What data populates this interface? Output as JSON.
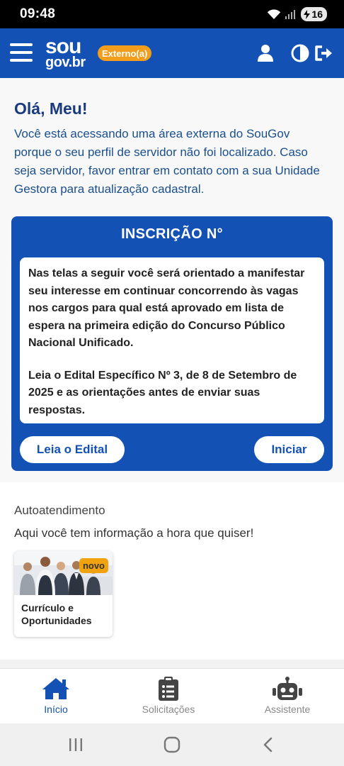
{
  "status_bar": {
    "time": "09:48",
    "battery": "16"
  },
  "header": {
    "logo_top": "sou",
    "logo_bottom": "gov.br",
    "badge": "Externo(a)",
    "icons": [
      "menu-icon",
      "user-icon",
      "contrast-icon",
      "logout-icon"
    ]
  },
  "greeting": {
    "title": "Olá, Meu!",
    "message": "Você está acessando uma área externa do SouGov porque o seu perfil de servidor não foi localizado. Caso seja servidor, favor entrar em contato com a sua Unidade Gestora para atualização cadastral."
  },
  "inscricao": {
    "title": "INSCRIÇÃO N°",
    "paragraph1": "Nas telas a seguir você será orientado a manifestar seu interesse em continuar concorrendo às vagas nos cargos para qual está aprovado em lista de espera na primeira edição do Concurso Público Nacional Unificado.",
    "paragraph2": "Leia o Edital Específico Nº 3, de 8 de Setembro de 2025 e as orientações antes de enviar suas respostas.",
    "edital_button": "Leia o Edital",
    "start_button": "Iniciar"
  },
  "autoatendimento": {
    "title": "Autoatendimento",
    "subtitle": "Aqui você tem informação a hora que quiser!",
    "cards": [
      {
        "badge": "novo",
        "label_line1": "Currículo e",
        "label_line2": "Oportunidades"
      }
    ]
  },
  "bottom_nav": {
    "items": [
      {
        "label": "Início",
        "icon": "home-icon",
        "active": true
      },
      {
        "label": "Solicitações",
        "icon": "clipboard-list-icon",
        "active": false
      },
      {
        "label": "Assistente",
        "icon": "robot-icon",
        "active": false
      }
    ]
  },
  "colors": {
    "primary": "#1351b4",
    "badge_orange": "#f29d1c",
    "novo_badge": "#f1a20f",
    "heading": "#1a3a80"
  }
}
